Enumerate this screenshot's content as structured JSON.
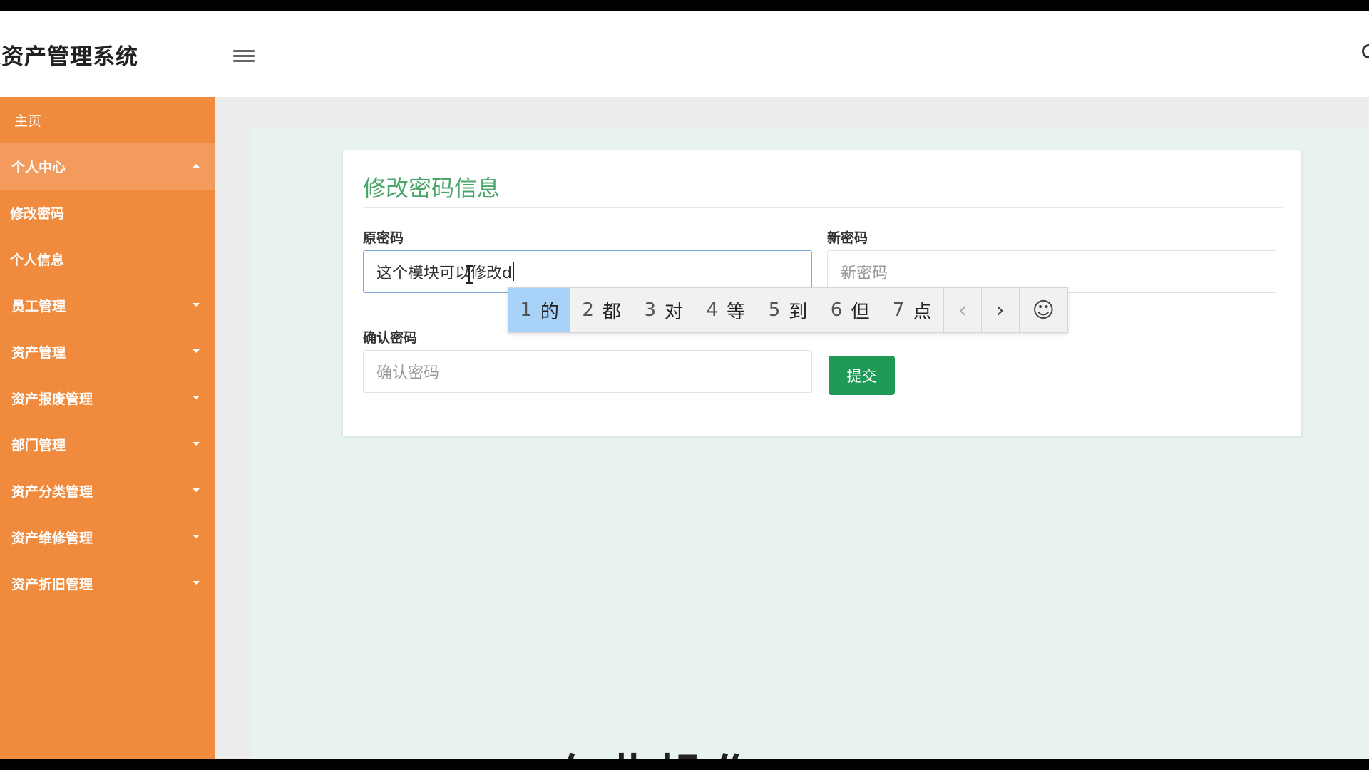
{
  "header": {
    "app_title": "定资产管理系统"
  },
  "sidebar": {
    "items": [
      {
        "label": "主页"
      },
      {
        "label": "个人中心"
      },
      {
        "label": "修改密码"
      },
      {
        "label": "个人信息"
      },
      {
        "label": "员工管理"
      },
      {
        "label": "资产管理"
      },
      {
        "label": "资产报废管理"
      },
      {
        "label": "部门管理"
      },
      {
        "label": "资产分类管理"
      },
      {
        "label": "资产维修管理"
      },
      {
        "label": "资产折旧管理"
      }
    ]
  },
  "form": {
    "title": "修改密码信息",
    "old_password": {
      "label": "原密码",
      "value": "这个模块可以修改d"
    },
    "new_password": {
      "label": "新密码",
      "placeholder": "新密码"
    },
    "confirm_password": {
      "label": "确认密码",
      "placeholder": "确认密码"
    },
    "submit_label": "提交"
  },
  "ime": {
    "candidates": [
      {
        "num": "1",
        "char": "的"
      },
      {
        "num": "2",
        "char": "都"
      },
      {
        "num": "3",
        "char": "对"
      },
      {
        "num": "4",
        "char": "等"
      },
      {
        "num": "5",
        "char": "到"
      },
      {
        "num": "6",
        "char": "但"
      },
      {
        "num": "7",
        "char": "点"
      }
    ],
    "prev": "‹",
    "next": "›",
    "emoji": "☺"
  },
  "overlay": {
    "bottom_text": "在此操作"
  },
  "colors": {
    "sidebar": "#f08a3c",
    "accent": "#4aa56a",
    "submit": "#1f9a55"
  }
}
